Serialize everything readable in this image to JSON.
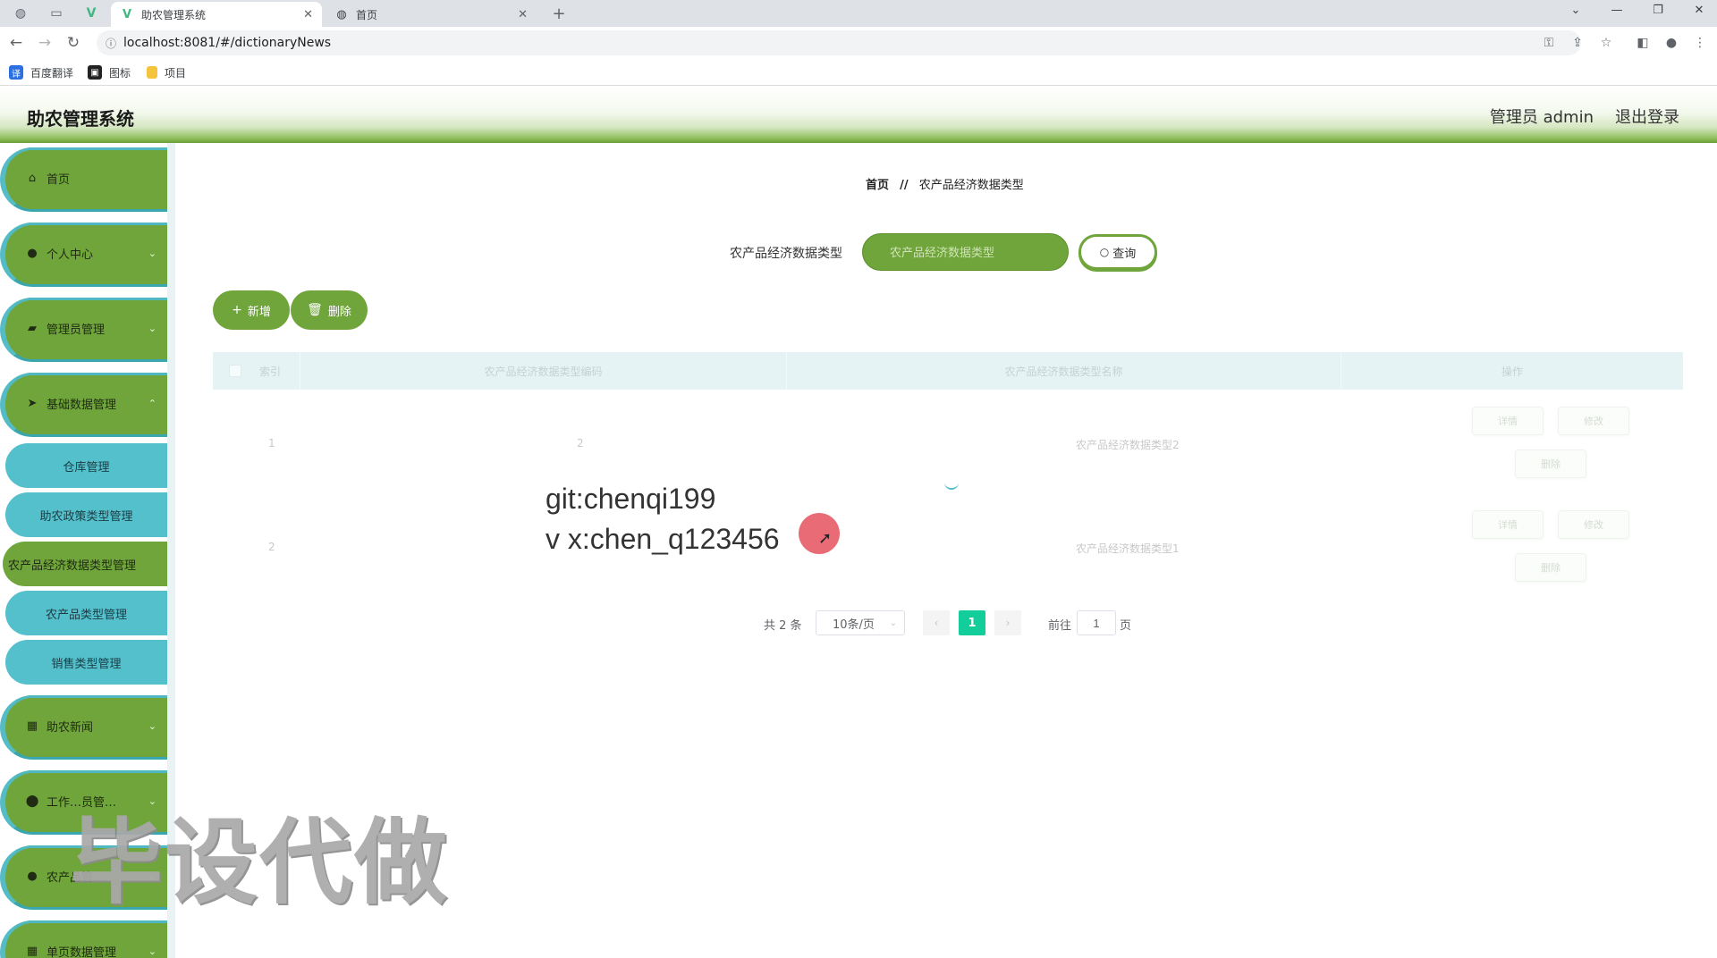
{
  "browser": {
    "tabs": [
      {
        "title": "助农管理系统",
        "active": true,
        "icon": "vue-logo-icon"
      },
      {
        "title": "首页",
        "active": false,
        "icon": "globe-icon"
      }
    ],
    "url": "localhost:8081/#/dictionaryNews",
    "bookmarks": [
      {
        "label": "百度翻译",
        "icon": "translate-icon",
        "color": "#2b6fe0"
      },
      {
        "label": "图标",
        "icon": "image-icon",
        "color": "#222222"
      },
      {
        "label": "项目",
        "icon": "folder-icon",
        "color": "#f3c43c"
      }
    ]
  },
  "header": {
    "title": "助农管理系统",
    "user": "管理员 admin",
    "logout": "退出登录"
  },
  "sidebar": {
    "items": [
      {
        "label": "首页",
        "icon": "home-icon",
        "expandable": false
      },
      {
        "label": "个人中心",
        "icon": "user-icon",
        "expandable": true
      },
      {
        "label": "管理员管理",
        "icon": "admin-icon",
        "expandable": true
      },
      {
        "label": "基础数据管理",
        "icon": "send-icon",
        "expandable": true
      },
      {
        "label": "助农新闻",
        "icon": "grid-icon",
        "expandable": true
      },
      {
        "label": "工作…员管…",
        "icon": "pin-icon",
        "expandable": true
      },
      {
        "label": "农产品管…",
        "icon": "user-icon",
        "expandable": true
      },
      {
        "label": "单页数据管理",
        "icon": "grid-icon",
        "expandable": true
      }
    ],
    "submenu": [
      {
        "label": "仓库管理",
        "active": false
      },
      {
        "label": "助农政策类型管理",
        "active": false
      },
      {
        "label": "农产品经济数据类型管理",
        "active": true
      },
      {
        "label": "农产品类型管理",
        "active": false
      },
      {
        "label": "销售类型管理",
        "active": false
      }
    ]
  },
  "breadcrumb": {
    "home": "首页",
    "separator": "//",
    "current": "农产品经济数据类型"
  },
  "search": {
    "label": "农产品经济数据类型",
    "placeholder": "农产品经济数据类型",
    "button": "查询"
  },
  "actions": {
    "add": "新增",
    "delete": "删除"
  },
  "table": {
    "headers": [
      "索引",
      "农产品经济数据类型编码",
      "农产品经济数据类型名称",
      "操作"
    ],
    "rows": [
      {
        "index": "1",
        "code": "2",
        "name": "农产品经济数据类型2"
      },
      {
        "index": "2",
        "code": "1",
        "name": "农产品经济数据类型1"
      }
    ],
    "row_actions": {
      "detail": "详情",
      "edit": "修改",
      "delete": "删除"
    }
  },
  "pagination": {
    "total": "共 2 条",
    "page_size": "10条/页",
    "current_page": "1",
    "goto_label": "前往",
    "goto_value": "1",
    "page_unit": "页"
  },
  "overlay": {
    "line1": "git:chenqi199",
    "line2": "v x:chen_q123456",
    "watermark": "毕设代做"
  },
  "colors": {
    "primary_green": "#6fa53a",
    "accent_cyan": "#53c0cc",
    "active_page": "#13ce9a"
  }
}
